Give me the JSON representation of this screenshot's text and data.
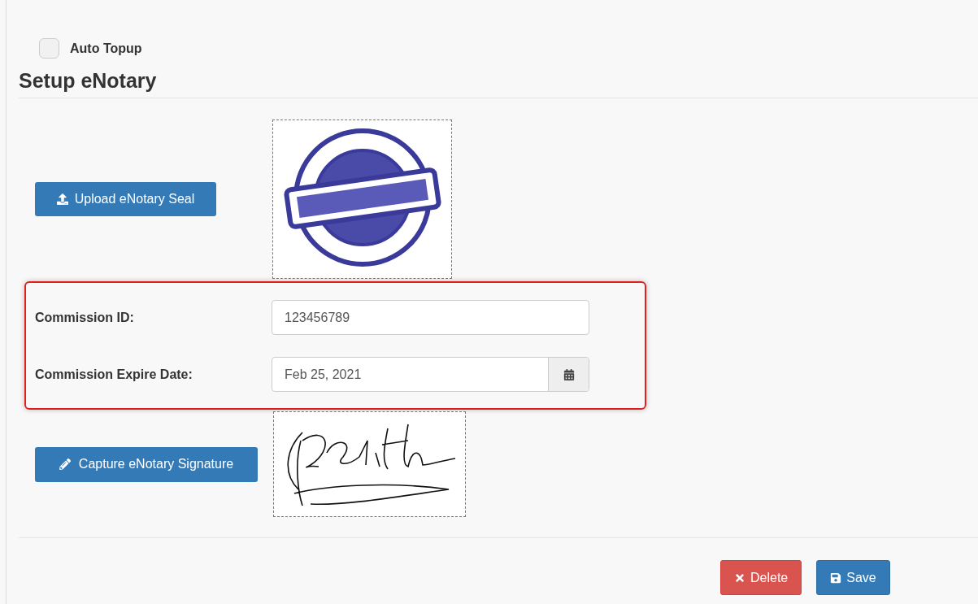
{
  "auto_topup": {
    "label": "Auto Topup",
    "checked": false
  },
  "section_title": "Setup eNotary",
  "upload_button": "Upload eNotary Seal",
  "fields": [
    {
      "label": "Commission ID:",
      "value": "123456789",
      "kind": "text"
    },
    {
      "label": "Commission Expire Date:",
      "value": "Feb 25, 2021",
      "kind": "date"
    }
  ],
  "capture_button": "Capture eNotary Signature",
  "actions": [
    {
      "label": "Delete",
      "kind": "delete"
    },
    {
      "label": "Save",
      "kind": "save"
    }
  ]
}
